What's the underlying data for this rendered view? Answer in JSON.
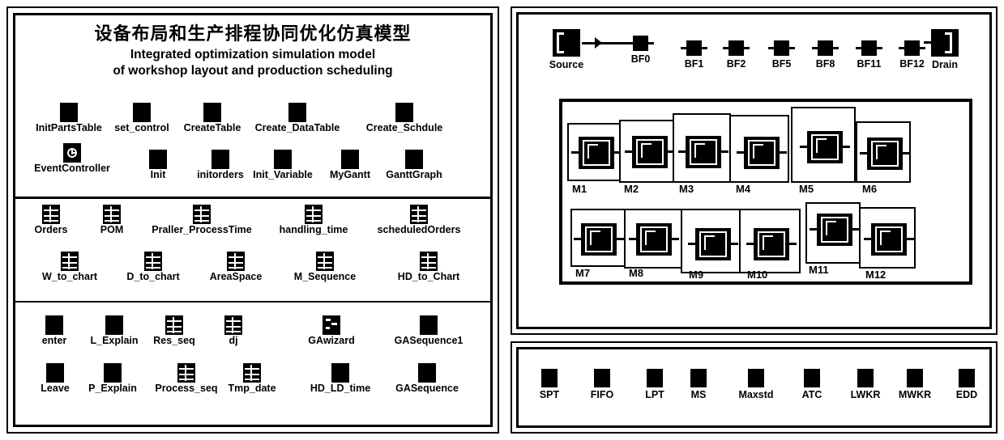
{
  "title": {
    "cn": "设备布局和生产排程协同优化仿真模型",
    "en_line1": "Integrated optimization simulation model",
    "en_line2": "of workshop layout and production scheduling"
  },
  "left_panel": {
    "section_methods": {
      "row1": [
        {
          "label": "InitPartsTable",
          "icon": "method-icon"
        },
        {
          "label": "set_control",
          "icon": "method-icon"
        },
        {
          "label": "CreateTable",
          "icon": "method-icon"
        },
        {
          "label": "Create_DataTable",
          "icon": "method-icon"
        },
        {
          "label": "Create_Schdule",
          "icon": "method-icon"
        }
      ],
      "row2": [
        {
          "label": "EventController",
          "icon": "event-controller-icon"
        },
        {
          "label": "Init",
          "icon": "method-icon"
        },
        {
          "label": "initorders",
          "icon": "method-icon"
        },
        {
          "label": "Init_Variable",
          "icon": "method-icon"
        },
        {
          "label": "MyGantt",
          "icon": "method-icon"
        },
        {
          "label": "GanttGraph",
          "icon": "method-icon"
        }
      ]
    },
    "section_tables": {
      "row1": [
        {
          "label": "Orders",
          "icon": "table-icon"
        },
        {
          "label": "POM",
          "icon": "table-icon"
        },
        {
          "label": "Praller_ProcessTime",
          "icon": "table-icon"
        },
        {
          "label": "handling_time",
          "icon": "table-icon"
        },
        {
          "label": "scheduledOrders",
          "icon": "table-icon"
        }
      ],
      "row2": [
        {
          "label": "W_to_chart",
          "icon": "table-icon"
        },
        {
          "label": "D_to_chart",
          "icon": "table-icon"
        },
        {
          "label": "AreaSpace",
          "icon": "table-icon"
        },
        {
          "label": "M_Sequence",
          "icon": "table-icon"
        },
        {
          "label": "HD_to_Chart",
          "icon": "table-icon"
        }
      ]
    },
    "section_ga": {
      "row1": [
        {
          "label": "enter",
          "icon": "method-icon"
        },
        {
          "label": "L_Explain",
          "icon": "method-icon"
        },
        {
          "label": "Res_seq",
          "icon": "table-icon"
        },
        {
          "label": "dj",
          "icon": "table-icon"
        },
        {
          "label": "GAwizard",
          "icon": "ga-wizard-icon"
        },
        {
          "label": "GASequence1",
          "icon": "method-icon"
        }
      ],
      "row2": [
        {
          "label": "Leave",
          "icon": "method-icon"
        },
        {
          "label": "P_Explain",
          "icon": "method-icon"
        },
        {
          "label": "Process_seq",
          "icon": "table-icon"
        },
        {
          "label": "Tmp_date",
          "icon": "table-icon"
        },
        {
          "label": "HD_LD_time",
          "icon": "method-icon"
        },
        {
          "label": "GASequence",
          "icon": "method-icon"
        }
      ]
    }
  },
  "right_panel": {
    "flow_row": {
      "source": {
        "label": "Source",
        "icon": "source-icon"
      },
      "buffers": [
        {
          "label": "BF0",
          "icon": "buffer-icon"
        },
        {
          "label": "BF1",
          "icon": "buffer-icon"
        },
        {
          "label": "BF2",
          "icon": "buffer-icon"
        },
        {
          "label": "BF5",
          "icon": "buffer-icon"
        },
        {
          "label": "BF8",
          "icon": "buffer-icon"
        },
        {
          "label": "BF11",
          "icon": "buffer-icon"
        },
        {
          "label": "BF12",
          "icon": "buffer-icon"
        }
      ],
      "drain": {
        "label": "Drain",
        "icon": "drain-icon"
      }
    },
    "machine_rows": [
      {
        "row": 1,
        "machines": [
          {
            "label": "M1",
            "icon": "machine-icon"
          },
          {
            "label": "M2",
            "icon": "machine-icon"
          },
          {
            "label": "M3",
            "icon": "machine-icon"
          },
          {
            "label": "M4",
            "icon": "machine-icon"
          },
          {
            "label": "M5",
            "icon": "machine-icon"
          },
          {
            "label": "M6",
            "icon": "machine-icon"
          }
        ]
      },
      {
        "row": 2,
        "machines": [
          {
            "label": "M7",
            "icon": "machine-icon"
          },
          {
            "label": "M8",
            "icon": "machine-icon"
          },
          {
            "label": "M9",
            "icon": "machine-icon"
          },
          {
            "label": "M10",
            "icon": "machine-icon"
          },
          {
            "label": "M11",
            "icon": "machine-icon"
          },
          {
            "label": "M12",
            "icon": "machine-icon"
          }
        ]
      }
    ]
  },
  "rules_panel": {
    "rules": [
      {
        "label": "SPT",
        "icon": "method-icon"
      },
      {
        "label": "FIFO",
        "icon": "method-icon"
      },
      {
        "label": "LPT",
        "icon": "method-icon"
      },
      {
        "label": "MS",
        "icon": "method-icon"
      },
      {
        "label": "Maxstd",
        "icon": "method-icon"
      },
      {
        "label": "ATC",
        "icon": "method-icon"
      },
      {
        "label": "LWKR",
        "icon": "method-icon"
      },
      {
        "label": "MWKR",
        "icon": "method-icon"
      },
      {
        "label": "EDD",
        "icon": "method-icon"
      }
    ]
  },
  "colors": {
    "background": "#ffffff",
    "foreground": "#000000"
  }
}
